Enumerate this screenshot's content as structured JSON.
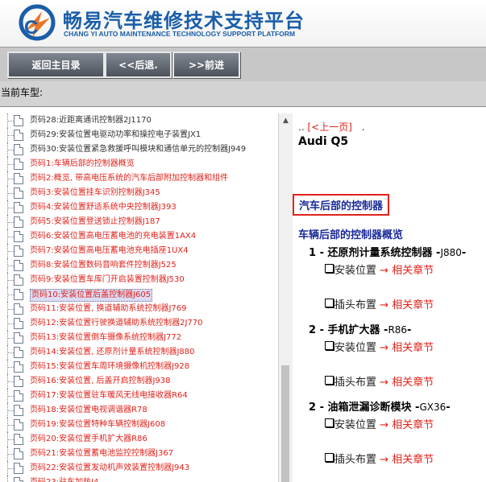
{
  "header": {
    "title_cn": "畅易汽车维修技术支持平台",
    "title_en": "CHANG YI AUTO MAINTENANCE TECHNOLOGY SUPPORT PLATFORM",
    "brand_color": "#1a5ea8"
  },
  "toolbar": {
    "home_label": "返回主目录",
    "back_label": "<<后退.",
    "forward_label": ">>前进"
  },
  "car_bar": {
    "label": "当前车型:"
  },
  "tree": {
    "items": [
      {
        "label": "页码28:近距离通讯控制器2J1170",
        "color": "dark"
      },
      {
        "label": "页码29:安装位置电驱动功率和操控电子装置JX1",
        "color": "dark"
      },
      {
        "label": "页码30:安装位置紧急救援呼叫模块和通信单元的控制器J949",
        "color": "dark"
      },
      {
        "label": "页码1:车辆后部的控制器概览",
        "color": "red"
      },
      {
        "label": "页码2:概览, 带高电压系统的汽车后部附加控制器和组件",
        "color": "red"
      },
      {
        "label": "页码3:安装位置挂车识别控制器J345",
        "color": "red"
      },
      {
        "label": "页码4:安装位置舒适系统中央控制器J393",
        "color": "red"
      },
      {
        "label": "页码5:安装位置登送锁止控制器J187",
        "color": "red"
      },
      {
        "label": "页码6:安装位置高电压蓄电池的充电装置1AX4",
        "color": "red"
      },
      {
        "label": "页码7:安装位置高电压蓄电池充电插座1UX4",
        "color": "red"
      },
      {
        "label": "页码8:安装位置数码音响套件控制器J525",
        "color": "red"
      },
      {
        "label": "页码9:安装位置车库门开启装置控制器J530",
        "color": "red"
      },
      {
        "label": "页码10:安装位置后盖控制器J605",
        "color": "red",
        "selected": true
      },
      {
        "label": "页码11:安装位置, 换道辅助系统控制器J769",
        "color": "red"
      },
      {
        "label": "页码12:安装位置行驶换道辅助系统控制器2J770",
        "color": "red"
      },
      {
        "label": "页码13:安装位置倒车摄像系统控制器J772",
        "color": "red"
      },
      {
        "label": "页码14:安装位置, 还原剂计量系统控制器J880",
        "color": "red"
      },
      {
        "label": "页码15:安装位置车周环境摄像机控制器J928",
        "color": "red"
      },
      {
        "label": "页码16:安装位置, 后盖开启控制器J938",
        "color": "red"
      },
      {
        "label": "页码17:安装位置驻车暖风无线电接收器R64",
        "color": "red"
      },
      {
        "label": "页码18:安装位置电视调谐器R78",
        "color": "red"
      },
      {
        "label": "页码19:安装位置特种车辆控制器J608",
        "color": "red"
      },
      {
        "label": "页码20:安装位置手机扩大器R86",
        "color": "red"
      },
      {
        "label": "页码21:安装位置蓄电池监控控制器J367",
        "color": "red"
      },
      {
        "label": "页码22:安装位置发动机声效装置控制器J943",
        "color": "red"
      },
      {
        "label": "页码23:驻车加热J4",
        "color": "red"
      }
    ]
  },
  "content": {
    "prev_prefix": "..",
    "prev_link": "[<上一页]",
    "prev_suffix": ".",
    "car_name": "Audi Q5",
    "section_title": "汽车后部的控制器",
    "subhead": "车辆后部的控制器概览",
    "arrow": "→",
    "items": [
      {
        "num": "1",
        "name": "还原剂计量系统控制器",
        "code": "J880",
        "rows": [
          {
            "label": "安装位置",
            "link": "相关章节"
          },
          {
            "label": "插头布置",
            "link": "相关章节"
          }
        ]
      },
      {
        "num": "2",
        "name": "手机扩大器",
        "code": "R86",
        "rows": [
          {
            "label": "安装位置",
            "link": "相关章节"
          },
          {
            "label": "插头布置",
            "link": "相关章节"
          }
        ]
      },
      {
        "num": "2",
        "name": "油箱泄漏诊断模块",
        "code": "GX36",
        "rows": [
          {
            "label": "安装位置",
            "link": "相关章节"
          },
          {
            "label": "插头布置",
            "link": "相关章节"
          }
        ]
      }
    ]
  }
}
